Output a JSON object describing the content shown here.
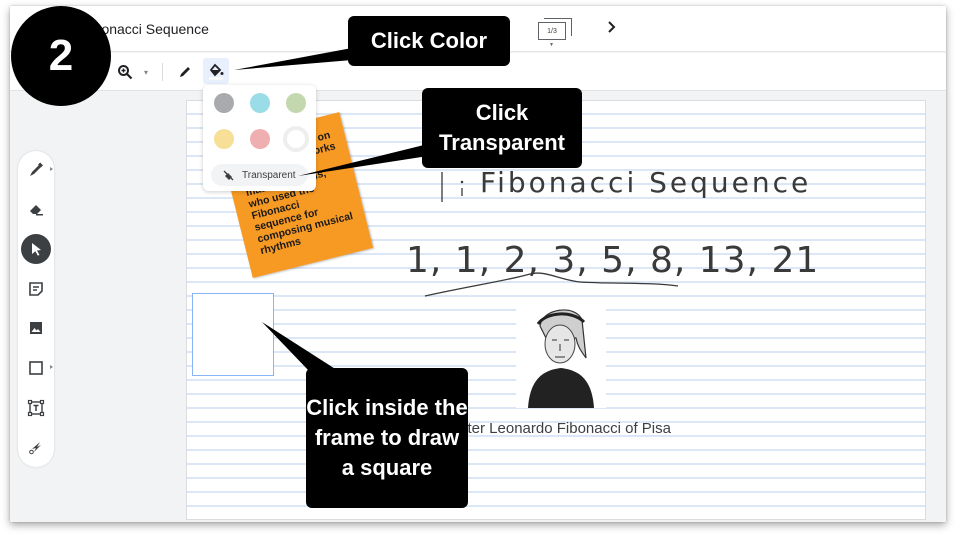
{
  "header": {
    "title": "Fibonacci Sequence",
    "slide_counter": "1/3",
    "next_icon": "chevron-right-icon"
  },
  "toolbar": {
    "zoom_icon": "zoom-in-icon",
    "pen_icon": "pen-icon",
    "fill_icon": "color-fill-icon"
  },
  "color_popup": {
    "swatches": [
      {
        "name": "gray",
        "color": "#a9aaad"
      },
      {
        "name": "cyan",
        "color": "#9bdde6"
      },
      {
        "name": "green",
        "color": "#c3d8ae"
      },
      {
        "name": "yellow",
        "color": "#f8df97"
      },
      {
        "name": "pink",
        "color": "#efafb0"
      },
      {
        "name": "white",
        "color": "#ffffff"
      }
    ],
    "transparent_label": "Transparent"
  },
  "tools": [
    {
      "name": "marker",
      "icon": "marker-icon",
      "has_submenu": true
    },
    {
      "name": "eraser",
      "icon": "eraser-icon"
    },
    {
      "name": "select",
      "icon": "cursor-icon",
      "active": true
    },
    {
      "name": "sticky-note",
      "icon": "sticky-note-icon"
    },
    {
      "name": "image",
      "icon": "image-icon"
    },
    {
      "name": "shape",
      "icon": "square-icon",
      "has_submenu": true
    },
    {
      "name": "text-box",
      "icon": "text-box-icon"
    },
    {
      "name": "laser",
      "icon": "laser-pointer-icon"
    }
  ],
  "canvas": {
    "sticky_note_text": "...ss to ...rdo ...p on of Pisa ... the works of Indian mathematicians, who used the Fibonacci sequence for composing musical rhythms",
    "handwriting_title": "Fibonacci Sequence",
    "handwriting_sequence": "1, 1, 2, 3, 5, 8, 13, 21, ...",
    "caption": "after Leonardo Fibonacci of Pisa"
  },
  "callouts": {
    "step_number": "2",
    "click_color": "Click Color",
    "click_transparent": "Click Transparent",
    "click_frame": "Click inside the frame to draw a square"
  }
}
